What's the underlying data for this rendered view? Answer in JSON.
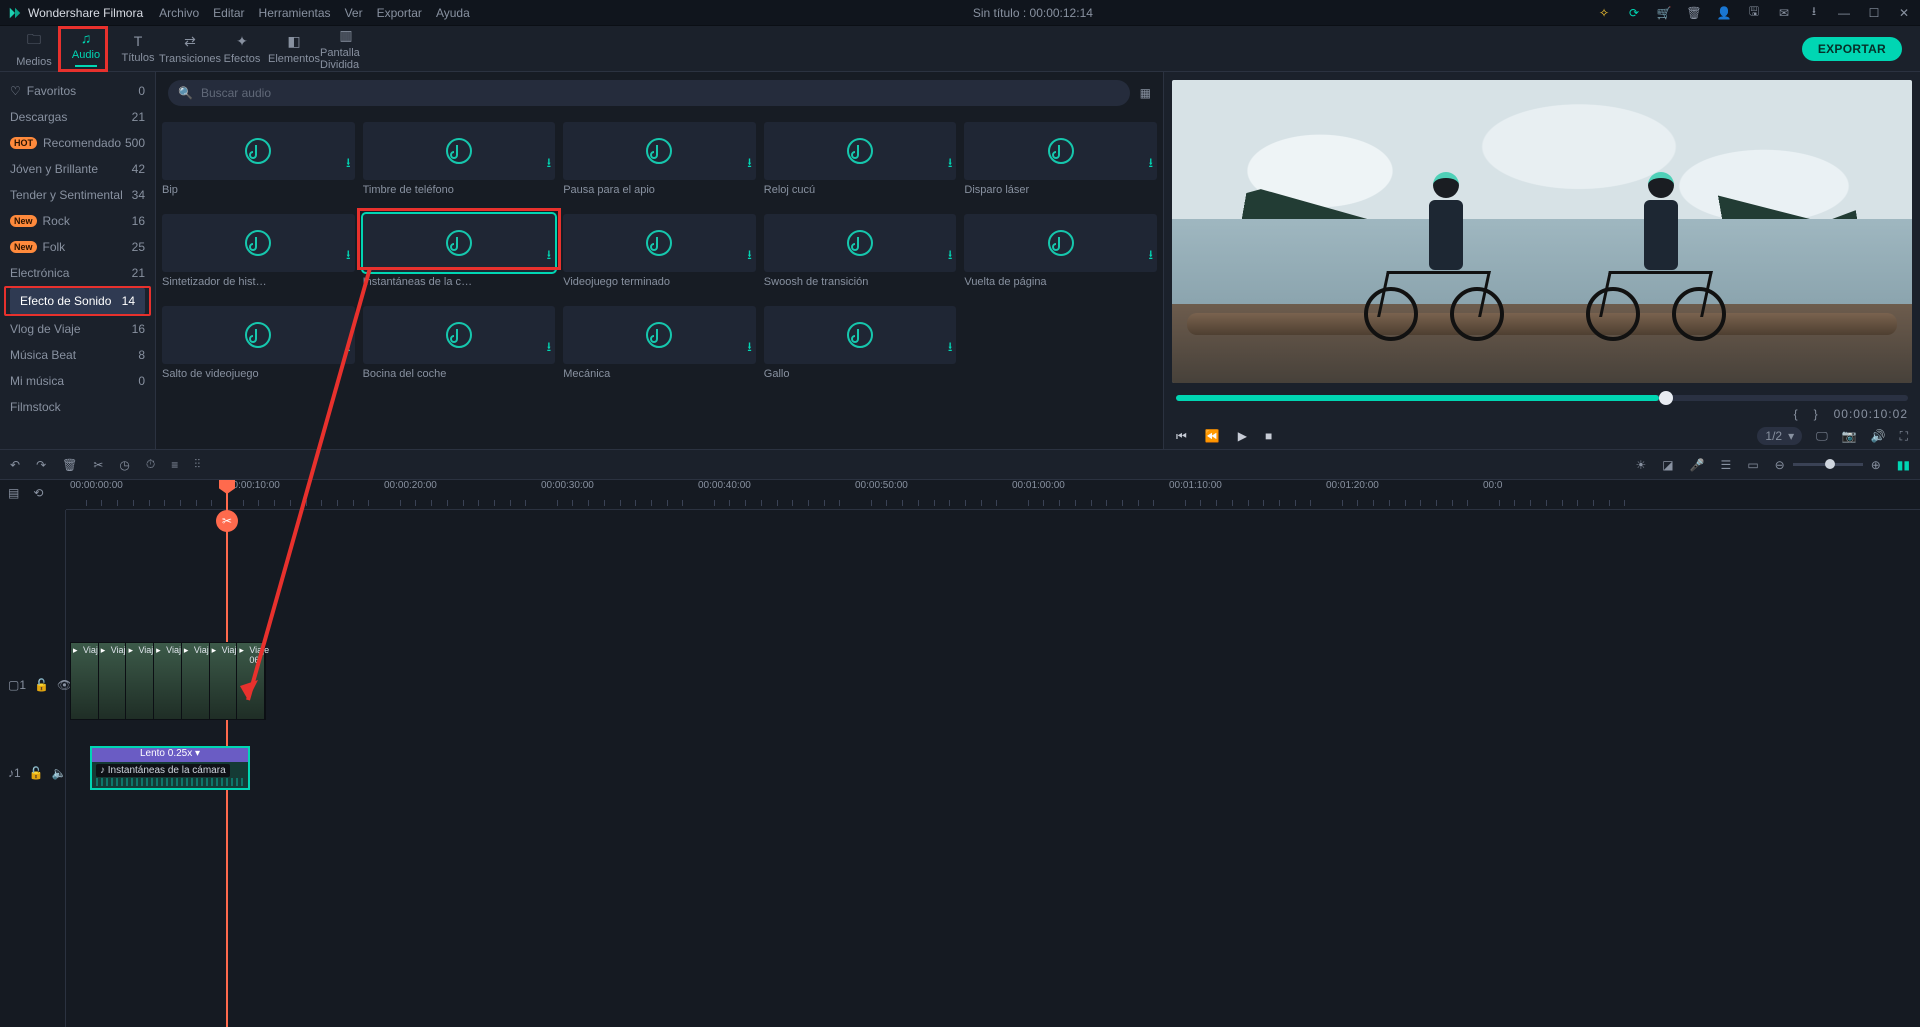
{
  "app_name": "Wondershare Filmora",
  "menu": [
    "Archivo",
    "Editar",
    "Herramientas",
    "Ver",
    "Exportar",
    "Ayuda"
  ],
  "title_center": "Sin título : 00:00:12:14",
  "main_tabs": [
    {
      "label": "Medios",
      "icon": "🗀"
    },
    {
      "label": "Audio",
      "icon": "♫"
    },
    {
      "label": "Títulos",
      "icon": "T"
    },
    {
      "label": "Transiciones",
      "icon": "⇄"
    },
    {
      "label": "Efectos",
      "icon": "✦"
    },
    {
      "label": "Elementos",
      "icon": "◧"
    },
    {
      "label": "Pantalla Dividida",
      "icon": "▥"
    }
  ],
  "active_tab_index": 1,
  "export_label": "EXPORTAR",
  "search_placeholder": "Buscar audio",
  "sidebar": [
    {
      "label": "Favoritos",
      "count": 0,
      "icon": "♡"
    },
    {
      "label": "Descargas",
      "count": 21
    },
    {
      "label": "Recomendado",
      "count": 500,
      "badge": "HOT"
    },
    {
      "label": "Jóven y Brillante",
      "count": 42
    },
    {
      "label": "Tender y Sentimental",
      "count": 34
    },
    {
      "label": "Rock",
      "count": 16,
      "badge": "New"
    },
    {
      "label": "Folk",
      "count": 25,
      "badge": "New"
    },
    {
      "label": "Electrónica",
      "count": 21
    },
    {
      "label": "Efecto de Sonido",
      "count": 14,
      "selected": true,
      "highlight": true
    },
    {
      "label": "Vlog de Viaje",
      "count": 16
    },
    {
      "label": "Música Beat",
      "count": 8
    },
    {
      "label": "Mi música",
      "count": 0
    },
    {
      "label": "Filmstock",
      "count": ""
    }
  ],
  "grid": [
    {
      "label": "Bip"
    },
    {
      "label": "Timbre de teléfono"
    },
    {
      "label": "Pausa para el apio"
    },
    {
      "label": "Reloj cucú"
    },
    {
      "label": "Disparo láser"
    },
    {
      "label": "Sintetizador de histor…"
    },
    {
      "label": "Instantáneas de la cá…",
      "selected": true,
      "highlight": true
    },
    {
      "label": "Videojuego terminado"
    },
    {
      "label": "Swoosh de transición"
    },
    {
      "label": "Vuelta de página"
    },
    {
      "label": "Salto de videojuego"
    },
    {
      "label": "Bocina del coche"
    },
    {
      "label": "Mecánica"
    },
    {
      "label": "Gallo"
    }
  ],
  "player": {
    "timecode": "00:00:10:02",
    "frame_label": "1/2",
    "brackets": {
      "in": "{",
      "out": "}"
    }
  },
  "ruler": [
    "00:00:00:00",
    "00:00:10:00",
    "00:00:20:00",
    "00:00:30:00",
    "00:00:40:00",
    "00:00:50:00",
    "00:01:00:00",
    "00:01:10:00",
    "00:01:20:00",
    "00:0"
  ],
  "video_clips": [
    {
      "name": "Viaj"
    },
    {
      "name": "Viaj"
    },
    {
      "name": "Viaj"
    },
    {
      "name": "Viaj"
    },
    {
      "name": "Viaj"
    },
    {
      "name": "Viaj"
    },
    {
      "name": "Viaje 06"
    }
  ],
  "audio_clip": {
    "speed_label": "Lento 0.25x ▾",
    "name": "Instantáneas de la cámara"
  },
  "track_labels": {
    "video": "⏵",
    "audio": "♪1"
  }
}
